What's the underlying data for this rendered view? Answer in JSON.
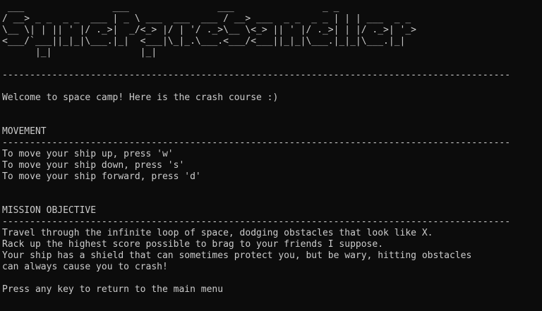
{
  "banner": {
    "ascii_art": " ___                ___                ___                _ _\n/ __> _ _  _ _  ___ | _ \\ ___  ___  ___ / __> ___  _ _  _ _ | | | ___  _ _\n\\__ \\| | || ' |/ ._>|  _/<_> |/ | '/ ._>\\__ \\<_> || ' |/ ._>| | |/ ._>| '_>\n<___/`___||_|_|\\___.|_|  <___|\\_|_.\\___.<___/<___||_|_|\\___.|_|_|\\___.|_|\n      |_|                |_|"
  },
  "divider": "--------------------------------------------------------------------------------------------",
  "welcome": "Welcome to space camp! Here is the crash course :)",
  "movement": {
    "heading": "MOVEMENT",
    "lines": [
      "To move your ship up, press 'w'",
      "To move your ship down, press 's'",
      "To move your ship forward, press 'd'"
    ]
  },
  "mission": {
    "heading": "MISSION OBJECTIVE",
    "lines": [
      "Travel through the infinite loop of space, dodging obstacles that look like X.",
      "Rack up the highest score possible to brag to your friends I suppose.",
      "Your ship has a shield that can sometimes protect you, but be wary, hitting obstacles",
      "can always cause you to crash!"
    ]
  },
  "prompt": "Press any key to return to the main menu"
}
